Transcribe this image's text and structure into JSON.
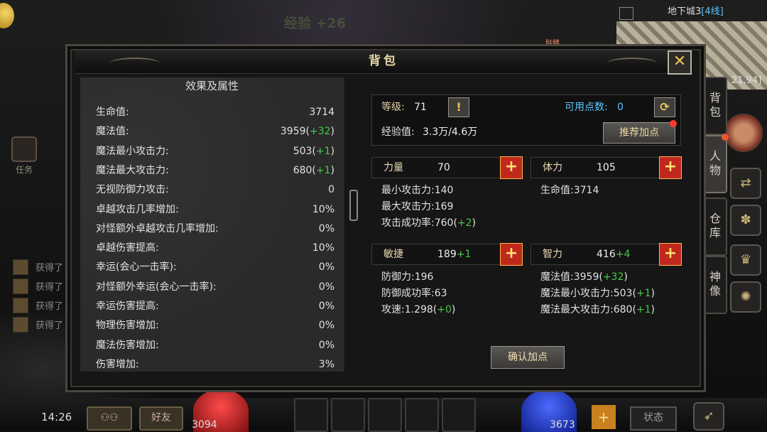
{
  "background": {
    "exp_float": "经验 +26",
    "quest_label": "任务",
    "loot_items": [
      "获得了",
      "获得了",
      "获得了",
      "获得了"
    ],
    "map": {
      "name": "地下城3",
      "line": "[4线]",
      "coords": "21,94]"
    },
    "mob_label": "骷髅",
    "side_tabs": [
      "背包",
      "人物",
      "仓库",
      "神像"
    ],
    "clock": "14:26",
    "buttons": {
      "friends": "好友",
      "status": "状态",
      "plus": "+"
    },
    "hp_value": "3094",
    "mp_value": "3673"
  },
  "panel": {
    "title": "背包",
    "close_icon": "✕",
    "left": {
      "heading": "效果及属性",
      "stats": [
        {
          "label": "生命值:",
          "value": "3714",
          "bonus": ""
        },
        {
          "label": "魔法值:",
          "value": "3959(",
          "bonus": "+32",
          "suffix": ")"
        },
        {
          "label": "魔法最小攻击力:",
          "value": "503(",
          "bonus": "+1",
          "suffix": ")"
        },
        {
          "label": "魔法最大攻击力:",
          "value": "680(",
          "bonus": "+1",
          "suffix": ")"
        },
        {
          "label": "无视防御力攻击:",
          "value": "0",
          "bonus": ""
        },
        {
          "label": "卓越攻击几率增加:",
          "value": "10%",
          "bonus": ""
        },
        {
          "label": "对怪额外卓越攻击几率增加:",
          "value": "0%",
          "bonus": ""
        },
        {
          "label": "卓越伤害提高:",
          "value": "10%",
          "bonus": ""
        },
        {
          "label": "幸运(会心一击率):",
          "value": "0%",
          "bonus": ""
        },
        {
          "label": "对怪额外幸运(会心一击率):",
          "value": "0%",
          "bonus": ""
        },
        {
          "label": "幸运伤害提高:",
          "value": "0%",
          "bonus": ""
        },
        {
          "label": "物理伤害增加:",
          "value": "0%",
          "bonus": ""
        },
        {
          "label": "魔法伤害增加:",
          "value": "0%",
          "bonus": ""
        },
        {
          "label": "伤害增加:",
          "value": "3%",
          "bonus": ""
        }
      ]
    },
    "right": {
      "level_label": "等级:",
      "level_value": "71",
      "info_icon": "!",
      "points_label": "可用点数:",
      "points_value": "0",
      "reset_icon": "⟳",
      "exp_label": "经验值:",
      "exp_value": "3.3万/4.6万",
      "recommend_button": "推荐加点",
      "attrs": {
        "str": {
          "name": "力量",
          "value": "70",
          "bonus": ""
        },
        "vit": {
          "name": "体力",
          "value": "105",
          "bonus": ""
        },
        "agi": {
          "name": "敏捷",
          "value": "189",
          "bonus": "+1"
        },
        "int": {
          "name": "智力",
          "value": "416",
          "bonus": "+4"
        }
      },
      "str_details": [
        {
          "label": "最小攻击力:",
          "value": "140",
          "bonus": ""
        },
        {
          "label": "最大攻击力:",
          "value": "169",
          "bonus": ""
        },
        {
          "label": "攻击成功率:",
          "value": "760(",
          "bonus": "+2",
          "suffix": ")"
        }
      ],
      "vit_details": [
        {
          "label": "生命值:",
          "value": "3714",
          "bonus": ""
        }
      ],
      "agi_details": [
        {
          "label": "防御力:",
          "value": "196",
          "bonus": ""
        },
        {
          "label": "防御成功率:",
          "value": "63",
          "bonus": ""
        },
        {
          "label": "攻速:",
          "value": "1.298(",
          "bonus": "+0",
          "suffix": ")"
        }
      ],
      "int_details": [
        {
          "label": "魔法值:",
          "value": "3959(",
          "bonus": "+32",
          "suffix": ")"
        },
        {
          "label": "魔法最小攻击力:",
          "value": "503(",
          "bonus": "+1",
          "suffix": ")"
        },
        {
          "label": "魔法最大攻击力:",
          "value": "680(",
          "bonus": "+1",
          "suffix": ")"
        }
      ],
      "plus_icon": "+",
      "confirm_button": "确认加点"
    }
  },
  "colors": {
    "accent_gold": "#e9d9a8",
    "bonus_green": "#47c847",
    "points_cyan": "#5cc6ff",
    "plus_red": "#c0281d"
  }
}
